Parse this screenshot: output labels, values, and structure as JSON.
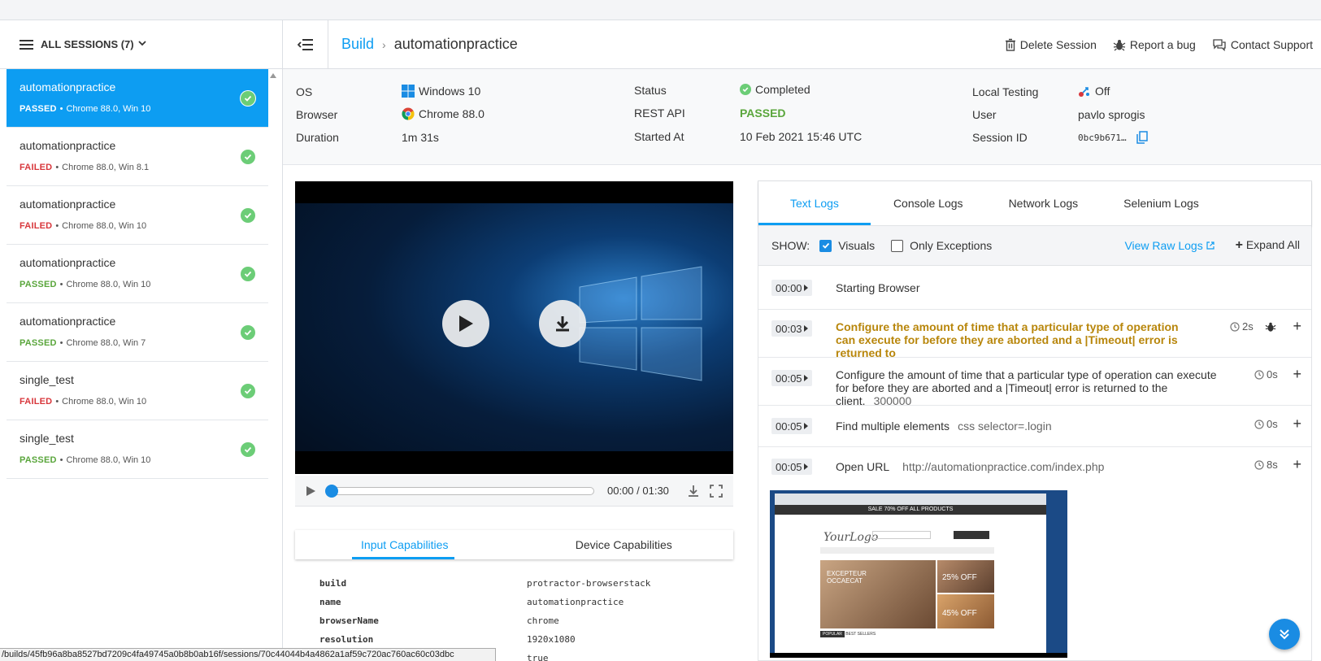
{
  "sidebar": {
    "title": "ALL SESSIONS (7)",
    "items": [
      {
        "title": "automationpractice",
        "status": "PASSED",
        "detail": "Chrome 88.0, Win 10"
      },
      {
        "title": "automationpractice",
        "status": "FAILED",
        "detail": "Chrome 88.0, Win 8.1"
      },
      {
        "title": "automationpractice",
        "status": "FAILED",
        "detail": "Chrome 88.0, Win 10"
      },
      {
        "title": "automationpractice",
        "status": "PASSED",
        "detail": "Chrome 88.0, Win 10"
      },
      {
        "title": "automationpractice",
        "status": "PASSED",
        "detail": "Chrome 88.0, Win 7"
      },
      {
        "title": "single_test",
        "status": "FAILED",
        "detail": "Chrome 88.0, Win 10"
      },
      {
        "title": "single_test",
        "status": "PASSED",
        "detail": "Chrome 88.0, Win 10"
      }
    ]
  },
  "statusbar": {
    "url": "/builds/45fb96a8ba8527bd7209c4fa49745a0b8b0ab16f/sessions/70c44044b4a4862a1af59c720ac760ac60c03dbc"
  },
  "header": {
    "breadcrumb_build": "Build",
    "breadcrumb_current": "automationpractice",
    "delete": "Delete Session",
    "report": "Report a bug",
    "contact": "Contact Support"
  },
  "info": {
    "os_label": "OS",
    "os_value": "Windows 10",
    "browser_label": "Browser",
    "browser_value": "Chrome 88.0",
    "duration_label": "Duration",
    "duration_value": "1m 31s",
    "status_label": "Status",
    "status_value": "Completed",
    "rest_label": "REST API",
    "rest_value": "PASSED",
    "started_label": "Started At",
    "started_value": "10 Feb 2021 15:46 UTC",
    "local_label": "Local Testing",
    "local_value": "Off",
    "user_label": "User",
    "user_value": "pavlo sprogis",
    "session_label": "Session ID",
    "session_value": "0bc9b671…"
  },
  "video": {
    "time": "00:00 / 01:30",
    "progress": 0
  },
  "capabilities": {
    "tab_input": "Input Capabilities",
    "tab_device": "Device Capabilities",
    "rows": [
      {
        "k": "build",
        "v": "protractor-browserstack"
      },
      {
        "k": "name",
        "v": "automationpractice"
      },
      {
        "k": "browserName",
        "v": "chrome"
      },
      {
        "k": "resolution",
        "v": "1920x1080"
      },
      {
        "k": "",
        "v": "true"
      }
    ]
  },
  "logs": {
    "tabs": [
      "Text Logs",
      "Console Logs",
      "Network Logs",
      "Selenium Logs"
    ],
    "show": "SHOW:",
    "visuals": "Visuals",
    "exceptions": "Only Exceptions",
    "raw": "View Raw Logs",
    "expand": "Expand All",
    "entries": [
      {
        "ts": "00:00",
        "msg": "Starting Browser",
        "arg": "",
        "dur": ""
      },
      {
        "ts": "00:03",
        "msg": "Configure the amount of time that a particular type of operation can execute for before they are aborted and a |Timeout| error is returned to",
        "arg": "",
        "dur": "2s"
      },
      {
        "ts": "00:05",
        "msg": "Configure the amount of time that a particular type of operation can execute for before they are aborted and a |Timeout| error is returned to the client.",
        "arg": "300000",
        "dur": "0s"
      },
      {
        "ts": "00:05",
        "msg": "Find multiple elements",
        "arg": "css selector=.login",
        "dur": "0s"
      },
      {
        "ts": "00:05",
        "msg": "Open URL",
        "arg": "http://automationpractice.com/index.php",
        "dur": "8s"
      }
    ]
  },
  "screenshot_thumb": {
    "banner": "SALE 70% OFF ALL PRODUCTS",
    "logo": "YourLogo",
    "promo1": "EXCEPTEUR OCCAECAT",
    "promo2": "25% OFF",
    "promo3": "45% OFF",
    "tab1": "POPULAR",
    "tab2": "BEST SELLERS"
  },
  "colors": {
    "accent": "#0d9df2",
    "passed": "#5aa63c",
    "failed": "#d8373c",
    "warn": "#b8860b"
  }
}
